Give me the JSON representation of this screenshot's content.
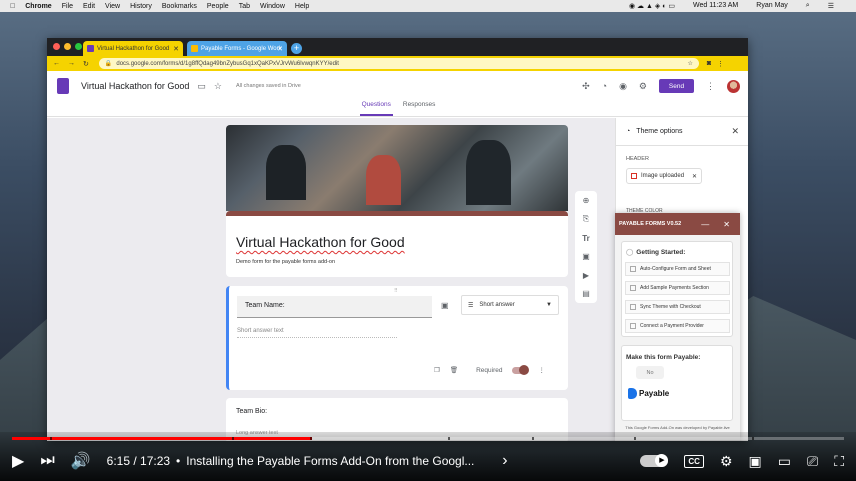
{
  "mac_menubar": {
    "app": "Chrome",
    "items": [
      "File",
      "Edit",
      "View",
      "History",
      "Bookmarks",
      "People",
      "Tab",
      "Window",
      "Help"
    ],
    "clock": "Wed 11:23 AM",
    "user": "Ryan May"
  },
  "browser": {
    "tabs": [
      {
        "label": "Virtual Hackathon for Good"
      },
      {
        "label": "Payable Forms - Google Work"
      }
    ],
    "url": "docs.google.com/forms/d/1g8ffQdag49bnZybusGq1xQaKPxVJrvWu6lvwqnKYY/edit"
  },
  "forms_header": {
    "title": "Virtual Hackathon for Good",
    "saved": "All changes saved in Drive",
    "send_label": "Send"
  },
  "view_tabs": {
    "questions": "Questions",
    "responses": "Responses"
  },
  "form": {
    "title": "Virtual Hackathon for Good",
    "description": "Demo form for the payable forms add-on",
    "question1": {
      "label": "Team Name:",
      "type": "Short answer",
      "placeholder": "Short answer text",
      "required_label": "Required"
    },
    "question2": {
      "label": "Team Bio:",
      "placeholder": "Long answer text"
    }
  },
  "theme_panel": {
    "title": "Theme options",
    "header_label": "HEADER",
    "image_chip": "Image uploaded",
    "theme_color_label": "THEME COLOR"
  },
  "payable": {
    "title": "PAYABLE FORMS V0.52",
    "getting_started": "Getting Started:",
    "steps": [
      "Auto-Configure Form and Sheet",
      "Add Sample Payments Section",
      "Sync Theme with Checkout",
      "Connect a Payment Provider"
    ],
    "make_payable": "Make this form Payable:",
    "no_label": "No",
    "logo_text": "Payable",
    "footer": "This Google Forms Add-On was developed by Payable.live"
  },
  "player": {
    "time_current": "6:15",
    "time_total": "17:23",
    "video_title": "Installing the Payable Forms Add-On from the Googl...",
    "progress_fraction": 0.36,
    "cc_label": "CC"
  }
}
